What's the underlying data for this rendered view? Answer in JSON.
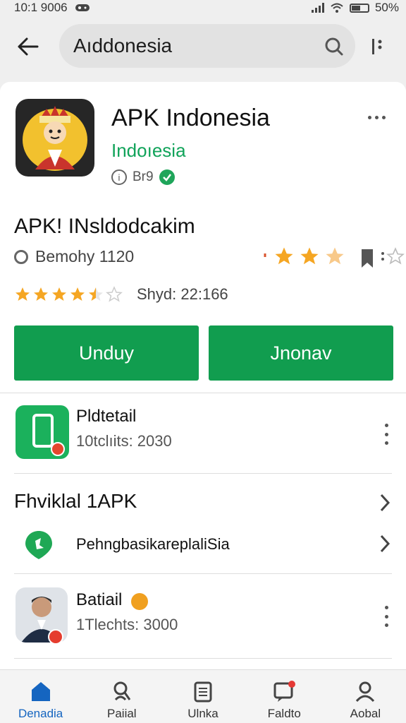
{
  "status_bar": {
    "time": "10:1 9006",
    "battery": "50%"
  },
  "search": {
    "value": "Aıddonesia"
  },
  "app": {
    "title": "APK Indonesia",
    "developer": "Indoıesia",
    "meta": "Br9"
  },
  "details": {
    "heading": "APK! INsldodcakim",
    "bemo": "Bemohy 1120",
    "rating_text": "Shyd: 22:166",
    "rating_stars": 4.5
  },
  "buttons": {
    "left": "Unduy",
    "right": "Jnonav"
  },
  "list": {
    "item1": {
      "title": "Pldtetail",
      "sub": "10tclıits: 2030"
    },
    "section_head": "Fhviklal 1APK",
    "loc_label": "PehngbasikareplaliSia",
    "item2": {
      "title": "Batiail",
      "sub": "1Tlechts: 3000"
    }
  },
  "nav": {
    "items": [
      {
        "label": "Denadia",
        "icon": "home-icon"
      },
      {
        "label": "Paiial",
        "icon": "search-person-icon"
      },
      {
        "label": "Ulnka",
        "icon": "calendar-icon"
      },
      {
        "label": "Faldto",
        "icon": "message-icon"
      },
      {
        "label": "Aobal",
        "icon": "profile-icon"
      }
    ]
  },
  "colors": {
    "accent": "#119d4f",
    "nav_active": "#1565c0",
    "star": "#f5a623"
  }
}
